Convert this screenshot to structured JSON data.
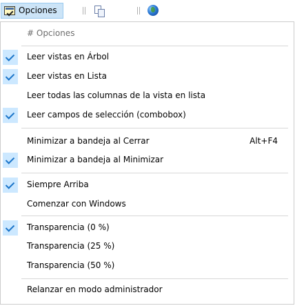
{
  "toolbar": {
    "opciones_label": "Opciones"
  },
  "menu": {
    "header": "# Opciones",
    "items": [
      {
        "label": "Leer vistas en Árbol",
        "checked": true
      },
      {
        "label": "Leer vistas en Lista",
        "checked": true
      },
      {
        "label": "Leer todas las columnas de la vista en lista",
        "checked": false
      },
      {
        "label": "Leer campos de selección (combobox)",
        "checked": true
      },
      {
        "label": "Minimizar a bandeja al Cerrar",
        "checked": false,
        "shortcut": "Alt+F4"
      },
      {
        "label": "Minimizar a bandeja al Minimizar",
        "checked": true
      },
      {
        "label": "Siempre Arriba",
        "checked": true
      },
      {
        "label": "Comenzar con Windows",
        "checked": false
      },
      {
        "label": "Transparencia (0 %)",
        "checked": true
      },
      {
        "label": "Transparencia (25 %)",
        "checked": false
      },
      {
        "label": "Transparencia (50 %)",
        "checked": false
      },
      {
        "label": "Relanzar en modo administrador",
        "checked": false
      }
    ]
  },
  "colors": {
    "highlight": "#cce4f7",
    "check_bg": "#cce8ff",
    "check_mark": "#1a74c9"
  },
  "icons": [
    "options-icon",
    "copy-icon",
    "globe-icon",
    "checkmark-icon"
  ]
}
